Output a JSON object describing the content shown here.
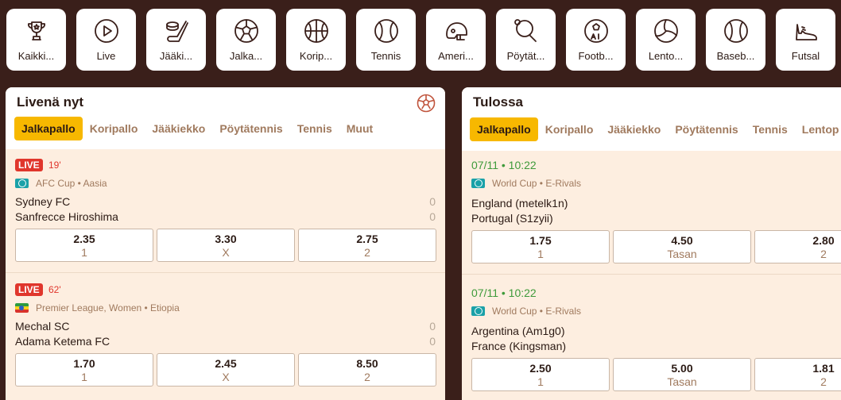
{
  "sports": [
    {
      "label": "Kaikki...",
      "icon": "trophy-icon"
    },
    {
      "label": "Live",
      "icon": "play-icon"
    },
    {
      "label": "Jääki...",
      "icon": "hockey-icon"
    },
    {
      "label": "Jalka...",
      "icon": "soccer-ball-icon"
    },
    {
      "label": "Korip...",
      "icon": "basketball-icon"
    },
    {
      "label": "Tennis",
      "icon": "tennis-ball-icon"
    },
    {
      "label": "Ameri...",
      "icon": "football-helmet-icon"
    },
    {
      "label": "Pöytät...",
      "icon": "table-tennis-icon"
    },
    {
      "label": "Footb...",
      "icon": "ai-soccer-icon"
    },
    {
      "label": "Lento...",
      "icon": "volleyball-icon"
    },
    {
      "label": "Baseb...",
      "icon": "baseball-icon"
    },
    {
      "label": "Futsal",
      "icon": "shoe-icon"
    }
  ],
  "live": {
    "title": "Livenä nyt",
    "tabs": [
      "Jalkapallo",
      "Koripallo",
      "Jääkiekko",
      "Pöytätennis",
      "Tennis",
      "Muut"
    ],
    "matches": [
      {
        "badge": "LIVE",
        "minute": "19'",
        "league": "AFC Cup • Aasia",
        "flag": "globe",
        "home": "Sydney FC",
        "away": "Sanfrecce Hiroshima",
        "home_score": "0",
        "away_score": "0",
        "odds": [
          {
            "v": "2.35",
            "k": "1"
          },
          {
            "v": "3.30",
            "k": "X"
          },
          {
            "v": "2.75",
            "k": "2"
          }
        ]
      },
      {
        "badge": "LIVE",
        "minute": "62'",
        "league": "Premier League, Women • Etiopia",
        "flag": "ethiopia",
        "home": "Mechal SC",
        "away": "Adama Ketema FC",
        "home_score": "0",
        "away_score": "0",
        "odds": [
          {
            "v": "1.70",
            "k": "1"
          },
          {
            "v": "2.45",
            "k": "X"
          },
          {
            "v": "8.50",
            "k": "2"
          }
        ]
      }
    ]
  },
  "upcoming": {
    "title": "Tulossa",
    "tabs": [
      "Jalkapallo",
      "Koripallo",
      "Jääkiekko",
      "Pöytätennis",
      "Tennis",
      "Lentop"
    ],
    "matches": [
      {
        "datetime": "07/11 • 10:22",
        "league": "World Cup • E-Rivals",
        "home": "England (metelk1n)",
        "away": "Portugal (S1zyii)",
        "odds": [
          {
            "v": "1.75",
            "k": "1"
          },
          {
            "v": "4.50",
            "k": "Tasan"
          },
          {
            "v": "2.80",
            "k": "2"
          }
        ]
      },
      {
        "datetime": "07/11 • 10:22",
        "league": "World Cup • E-Rivals",
        "home": "Argentina (Am1g0)",
        "away": "France (Kingsman)",
        "odds": [
          {
            "v": "2.50",
            "k": "1"
          },
          {
            "v": "5.00",
            "k": "Tasan"
          },
          {
            "v": "1.81",
            "k": "2"
          }
        ]
      }
    ]
  }
}
